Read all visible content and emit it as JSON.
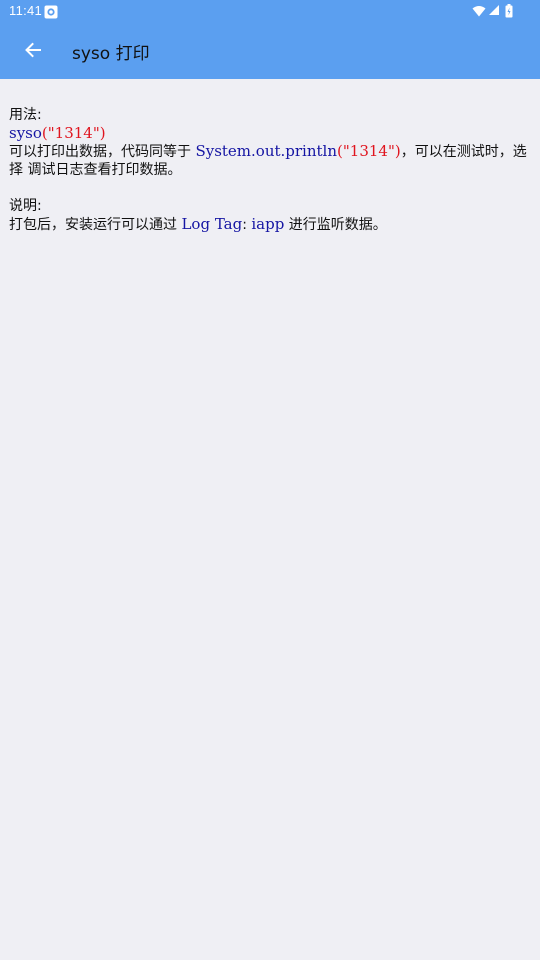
{
  "status_bar": {
    "time": "11:41",
    "app_icon": "camera-notification-icon",
    "wifi_icon": "wifi-icon",
    "signal_icon": "cell-signal-icon",
    "battery_icon": "battery-icon"
  },
  "app_bar": {
    "background": "#5b9ff0",
    "back_icon": "arrow-left-icon",
    "title": "syso 打印"
  },
  "content": {
    "usage_heading": "用法:",
    "usage_code": {
      "func": "syso",
      "open": "(",
      "arg": "\"1314\"",
      "close": ")"
    },
    "desc_line1": {
      "prefix": "可以打印出数据，代码同等于 ",
      "code_func": "System.out.println",
      "code_open": "(",
      "code_arg": "\"1314\"",
      "code_close": ")",
      "suffix": "，可以在测试时，选"
    },
    "desc_line2": "择 调试日志查看打印数据。",
    "note_heading": "说明:",
    "note_line": {
      "prefix": "打包后，安装运行可以通过 ",
      "tag_label": "Log Tag",
      "sep": ": ",
      "tag_value": "iapp",
      "suffix": " 进行监听数据。"
    }
  },
  "colors": {
    "page_bg": "#efeff4",
    "code_blue": "#1515a3",
    "code_red": "#e0141e"
  }
}
